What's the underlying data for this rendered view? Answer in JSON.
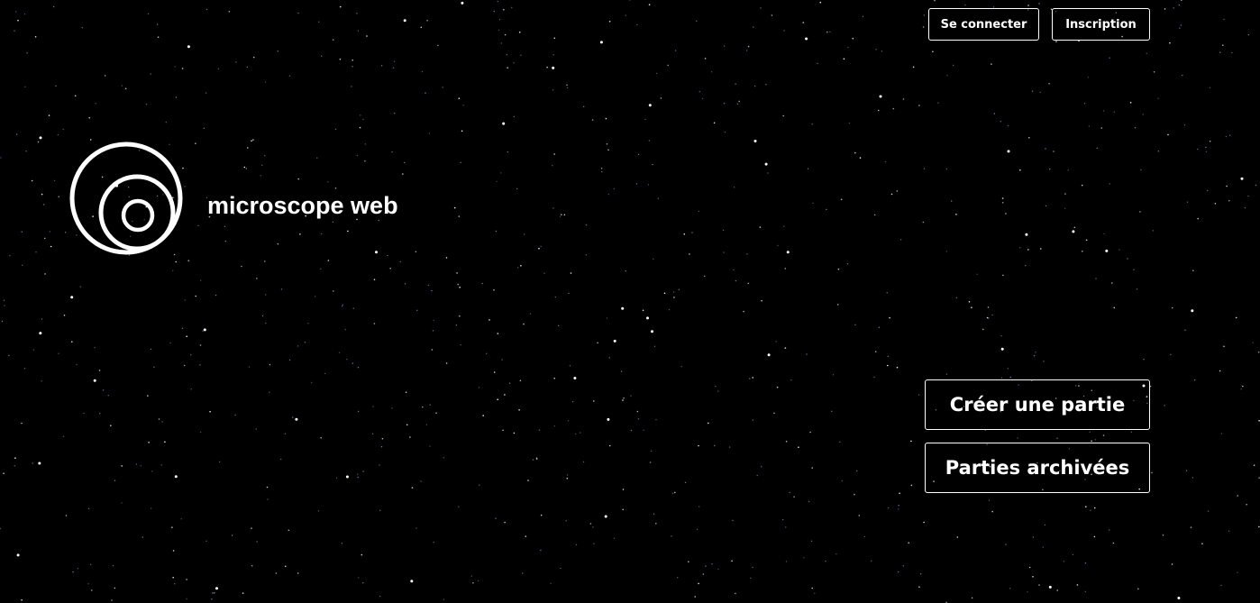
{
  "header": {
    "login_label": "Se connecter",
    "signup_label": "Inscription"
  },
  "brand": {
    "title": "microscope web",
    "logo_icon": "concentric-circles-logo-icon"
  },
  "actions": {
    "create_game_label": "Créer une partie",
    "archived_games_label": "Parties archivées"
  },
  "colors": {
    "background": "#000000",
    "foreground": "#ffffff",
    "star_blue": "#6f8fd6"
  }
}
